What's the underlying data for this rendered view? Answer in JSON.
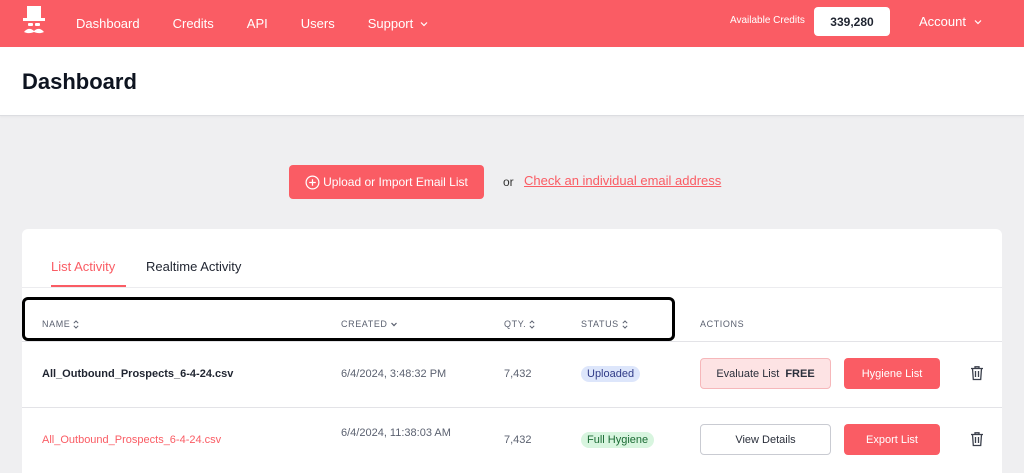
{
  "nav": {
    "items": [
      {
        "label": "Dashboard",
        "has_dropdown": false
      },
      {
        "label": "Credits",
        "has_dropdown": false
      },
      {
        "label": "API",
        "has_dropdown": false
      },
      {
        "label": "Users",
        "has_dropdown": false
      },
      {
        "label": "Support",
        "has_dropdown": true
      }
    ],
    "credits_label": "Available Credits",
    "credits_value": "339,280",
    "account_label": "Account",
    "logo_icon": "top-hat-mustache-logo",
    "brand_color": "#fa5c64"
  },
  "page": {
    "title": "Dashboard"
  },
  "upload": {
    "button_label": "Upload or Import Email List",
    "or_text": "or",
    "check_link": "Check an individual email address"
  },
  "tabs": [
    {
      "label": "List Activity",
      "active": true
    },
    {
      "label": "Realtime Activity",
      "active": false
    }
  ],
  "table": {
    "columns": [
      {
        "label": "NAME",
        "sort_icon": "sort-both"
      },
      {
        "label": "CREATED",
        "sort_icon": "sort-down"
      },
      {
        "label": "QTY.",
        "sort_icon": "sort-both"
      },
      {
        "label": "STATUS",
        "sort_icon": "sort-both"
      },
      {
        "label": "ACTIONS",
        "sort_icon": ""
      }
    ],
    "rows": [
      {
        "name": "All_Outbound_Prospects_6-4-24.csv",
        "created": "6/4/2024, 3:48:32 PM",
        "qty": "7,432",
        "status": "Uploaded",
        "action1": "Evaluate List",
        "action1_tag": "FREE",
        "action2": "Hygiene List"
      },
      {
        "name": "All_Outbound_Prospects_6-4-24.csv",
        "created": "6/4/2024, 11:38:03 AM",
        "qty": "7,432",
        "status": "Full Hygiene",
        "action1": "View Details",
        "action2": "Export List"
      }
    ]
  }
}
